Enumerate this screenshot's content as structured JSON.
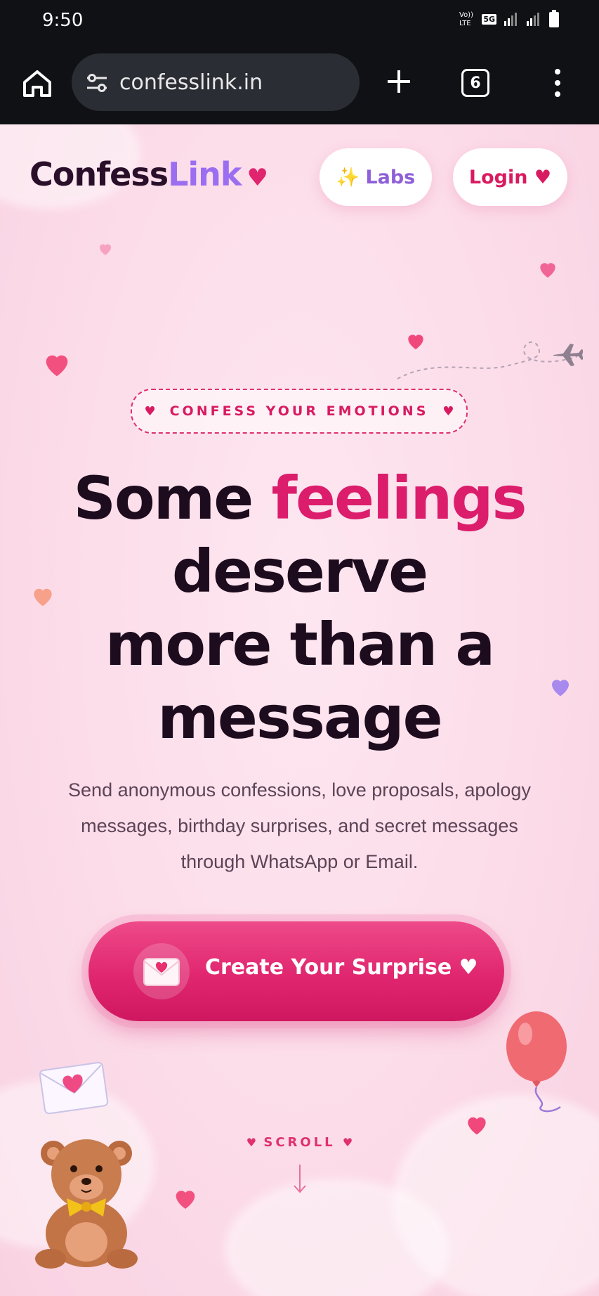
{
  "status_bar": {
    "time": "9:50",
    "network_label": "5G"
  },
  "browser": {
    "url": "confesslink.in",
    "tab_count": "6"
  },
  "nav": {
    "logo_part1": "Confess",
    "logo_part2": "Link",
    "logo_heart": "♥",
    "labs_icon": "✨",
    "labs_label": "Labs",
    "login_label": "Login ♥"
  },
  "hero": {
    "badge_heart": "♥",
    "badge_text": "CONFESS YOUR EMOTIONS",
    "headline_part1": "Some ",
    "headline_accent": "feelings",
    "headline_line2": "deserve",
    "headline_line3": "more than a",
    "headline_line4": "message",
    "subtitle": "Send anonymous confessions, love proposals, apology messages, birthday surprises, and secret messages through WhatsApp or Email.",
    "cta_label": "Create Your Surprise ♥"
  },
  "scroll": {
    "heart": "♥",
    "label": "SCROLL"
  },
  "colors": {
    "brand_pink": "#db1d6c",
    "brand_purple": "#9b6df0",
    "dark_text": "#1d0b1e"
  },
  "icons": [
    "home-icon",
    "site-settings-icon",
    "plus-icon",
    "tabs-icon",
    "more-vert-icon",
    "heart-icon",
    "sparkles-icon",
    "envelope-icon",
    "airplane-icon",
    "balloon-icon",
    "teddy-bear-icon",
    "arrow-down-icon"
  ]
}
